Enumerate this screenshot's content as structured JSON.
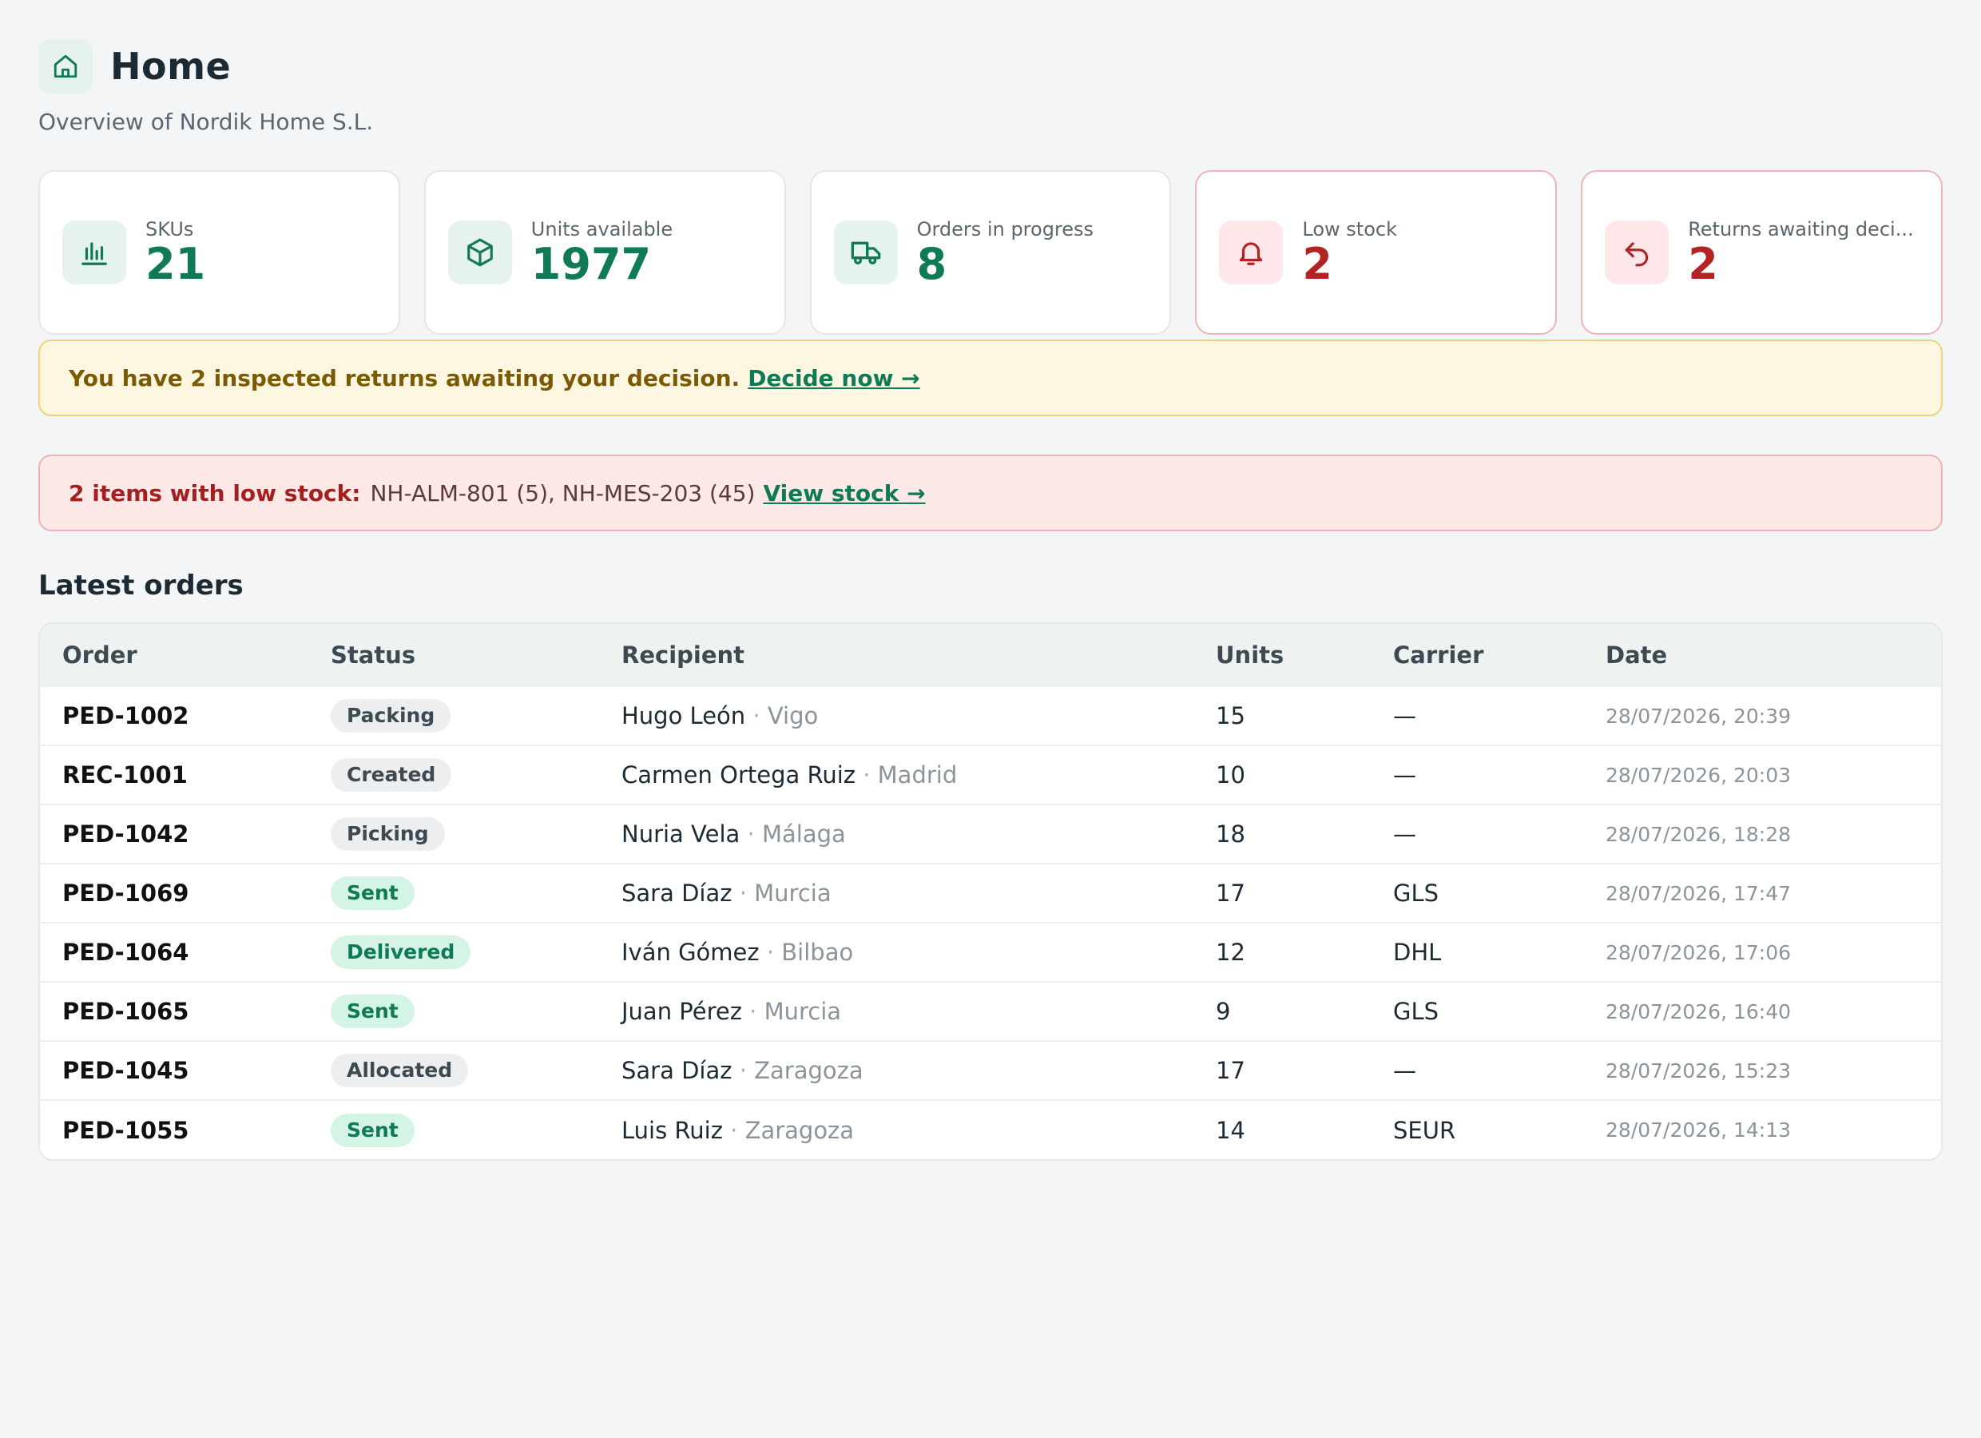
{
  "header": {
    "icon": "home-icon",
    "title": "Home",
    "subtitle": "Overview of Nordik Home S.L."
  },
  "stats": [
    {
      "icon": "bar-chart-icon",
      "label": "SKUs",
      "value": "21",
      "tone": "normal"
    },
    {
      "icon": "box-icon",
      "label": "Units available",
      "value": "1977",
      "tone": "normal"
    },
    {
      "icon": "truck-icon",
      "label": "Orders in progress",
      "value": "8",
      "tone": "normal"
    },
    {
      "icon": "bell-icon",
      "label": "Low stock",
      "value": "2",
      "tone": "alert"
    },
    {
      "icon": "return-arrow-icon",
      "label": "Returns awaiting deci...",
      "value": "2",
      "tone": "alert"
    }
  ],
  "returns_banner": {
    "text": "You have 2 inspected returns awaiting your decision.",
    "link": "Decide now →"
  },
  "lowstock_banner": {
    "strong": "2 items with low stock:",
    "items": "NH-ALM-801 (5), NH-MES-203 (45)",
    "link": "View stock →"
  },
  "orders": {
    "title": "Latest orders",
    "columns": [
      "Order",
      "Status",
      "Recipient",
      "Units",
      "Carrier",
      "Date"
    ],
    "rows": [
      {
        "order": "PED-1002",
        "status": "Packing",
        "status_tone": "gray",
        "name": "Hugo León",
        "sep": "·",
        "city": "Vigo",
        "units": "15",
        "carrier": "—",
        "date": "28/07/2026, 20:39"
      },
      {
        "order": "REC-1001",
        "status": "Created",
        "status_tone": "gray",
        "name": "Carmen Ortega Ruiz",
        "sep": "·",
        "city": "Madrid",
        "units": "10",
        "carrier": "—",
        "date": "28/07/2026, 20:03"
      },
      {
        "order": "PED-1042",
        "status": "Picking",
        "status_tone": "gray",
        "name": "Nuria Vela",
        "sep": "·",
        "city": "Málaga",
        "units": "18",
        "carrier": "—",
        "date": "28/07/2026, 18:28"
      },
      {
        "order": "PED-1069",
        "status": "Sent",
        "status_tone": "green",
        "name": "Sara Díaz",
        "sep": "·",
        "city": "Murcia",
        "units": "17",
        "carrier": "GLS",
        "date": "28/07/2026, 17:47"
      },
      {
        "order": "PED-1064",
        "status": "Delivered",
        "status_tone": "green",
        "name": "Iván Gómez",
        "sep": "·",
        "city": "Bilbao",
        "units": "12",
        "carrier": "DHL",
        "date": "28/07/2026, 17:06"
      },
      {
        "order": "PED-1065",
        "status": "Sent",
        "status_tone": "green",
        "name": "Juan Pérez",
        "sep": "·",
        "city": "Murcia",
        "units": "9",
        "carrier": "GLS",
        "date": "28/07/2026, 16:40"
      },
      {
        "order": "PED-1045",
        "status": "Allocated",
        "status_tone": "gray",
        "name": "Sara Díaz",
        "sep": "·",
        "city": "Zaragoza",
        "units": "17",
        "carrier": "—",
        "date": "28/07/2026, 15:23"
      },
      {
        "order": "PED-1055",
        "status": "Sent",
        "status_tone": "green",
        "name": "Luis Ruiz",
        "sep": "·",
        "city": "Zaragoza",
        "units": "14",
        "carrier": "SEUR",
        "date": "28/07/2026, 14:13"
      }
    ]
  },
  "colors": {
    "accent": "#0f7a55",
    "alert": "#b42323",
    "warning_bg": "#fdf7e2",
    "danger_bg": "#fde8e8"
  }
}
